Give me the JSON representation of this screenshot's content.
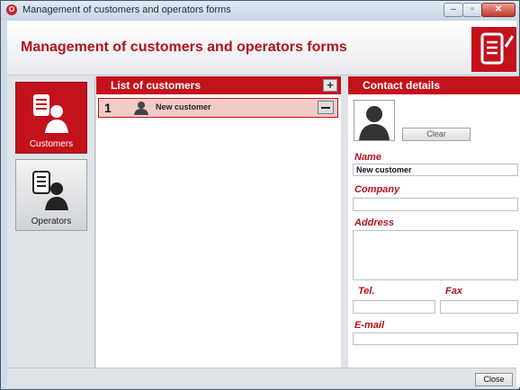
{
  "window": {
    "title": "Management of customers and operators forms",
    "app_icon_glyph": "O"
  },
  "header": {
    "title": "Management of customers and operators forms",
    "logo_icon": "form-pen-icon"
  },
  "nav": {
    "items": [
      {
        "label": "Customers",
        "icon": "customer-icon",
        "active": true
      },
      {
        "label": "Operators",
        "icon": "operator-icon",
        "active": false
      }
    ]
  },
  "list": {
    "title": "List of customers",
    "add_icon": "plus-icon",
    "rows": [
      {
        "number": "1",
        "name": "New customer",
        "remove_icon": "minus-icon"
      }
    ]
  },
  "contact": {
    "title": "Contact details",
    "clear_label": "Clear",
    "name_label": "Name",
    "name_value": "New customer",
    "company_label": "Company",
    "company_value": "",
    "address_label": "Address",
    "address_value": "",
    "tel_label": "Tel.",
    "tel_value": "",
    "fax_label": "Fax",
    "fax_value": "",
    "email_label": "E-mail",
    "email_value": ""
  },
  "footer": {
    "close_label": "Close"
  },
  "colors": {
    "accent": "#c4121c",
    "selected_row": "#f1ccc6",
    "label_red": "#b3131d"
  }
}
